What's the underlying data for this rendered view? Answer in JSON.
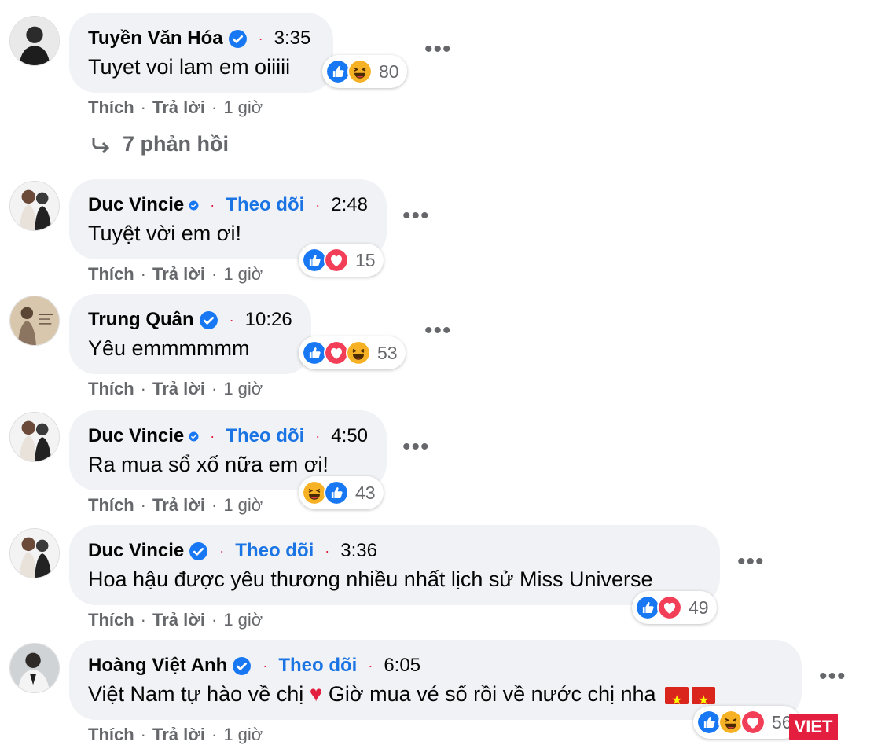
{
  "comments": [
    {
      "name": "Tuyền Văn Hóa",
      "follow": "",
      "time": "3:35",
      "text": "Tuyet voi lam em oiiiii",
      "reaction_icons": [
        "like-icon",
        "haha-icon"
      ],
      "reaction_count": "80",
      "actions": {
        "like": "Thích",
        "reply": "Trả lời",
        "age": "1 giờ"
      }
    },
    {
      "name": "Duc Vincie",
      "follow": "Theo dõi",
      "time": "2:48",
      "text": "Tuyệt vời em ơi!",
      "reaction_icons": [
        "like-icon",
        "love-icon"
      ],
      "reaction_count": "15",
      "actions": {
        "like": "Thích",
        "reply": "Trả lời",
        "age": "1 giờ"
      }
    },
    {
      "name": "Trung Quân",
      "follow": "",
      "time": "10:26",
      "text": "Yêu emmmmmm",
      "reaction_icons": [
        "like-icon",
        "love-icon",
        "haha-icon"
      ],
      "reaction_count": "53",
      "actions": {
        "like": "Thích",
        "reply": "Trả lời",
        "age": "1 giờ"
      }
    },
    {
      "name": "Duc Vincie",
      "follow": "Theo dõi",
      "time": "4:50",
      "text": "Ra mua sổ xố nữa em ơi!",
      "reaction_icons": [
        "haha-icon",
        "like-icon"
      ],
      "reaction_count": "43",
      "actions": {
        "like": "Thích",
        "reply": "Trả lời",
        "age": "1 giờ"
      }
    },
    {
      "name": "Duc Vincie",
      "follow": "Theo dõi",
      "time": "3:36",
      "text": "Hoa hậu được yêu thương nhiều nhất lịch sử Miss Universe",
      "reaction_icons": [
        "like-icon",
        "love-icon"
      ],
      "reaction_count": "49",
      "actions": {
        "like": "Thích",
        "reply": "Trả lời",
        "age": "1 giờ"
      }
    },
    {
      "name": "Hoàng Việt Anh",
      "follow": "Theo dõi",
      "time": "6:05",
      "text_a": "Việt Nam tự hào về chị",
      "text_b": "Giờ mua vé số rồi về nước chị nha",
      "reaction_icons": [
        "like-icon",
        "haha-icon",
        "love-icon"
      ],
      "reaction_count": "56",
      "actions": {
        "like": "Thích",
        "reply": "Trả lời",
        "age": "1 giờ"
      }
    }
  ],
  "replies_link": "7 phản hồi",
  "logo_text": "VIET",
  "colors": {
    "bubble": "#f0f2f5",
    "link": "#1b74e4",
    "meta": "#65676b",
    "dot": "#e41e3f",
    "like": "#1877f2",
    "love": "#f33e58",
    "haha": "#f7b125"
  }
}
